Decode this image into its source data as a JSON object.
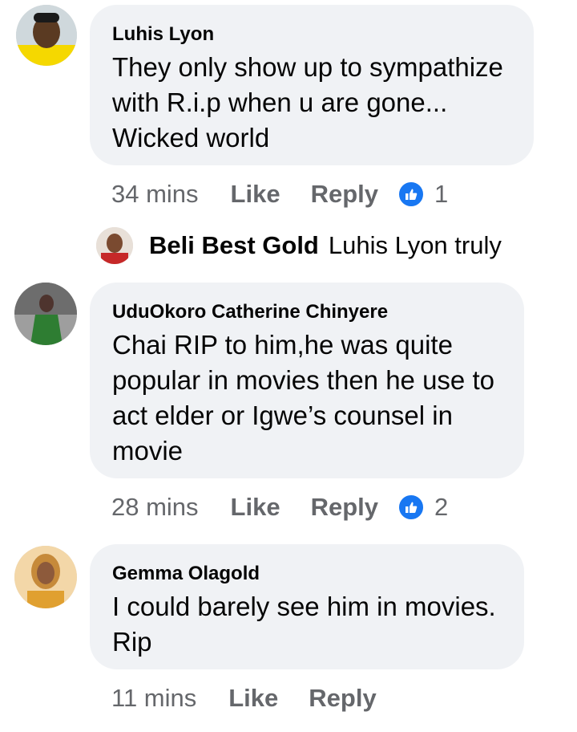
{
  "comments": [
    {
      "author": "Luhis Lyon",
      "text_lines": [
        "They only show up to sympathize",
        "with R.i.p when u are gone...",
        "Wicked world"
      ],
      "time": "34 mins",
      "like_label": "Like",
      "reply_label": "Reply",
      "reaction_icon": "thumbs-up-icon",
      "reaction_count": "1",
      "reply": {
        "author": "Beli Best Gold",
        "text": "Luhis Lyon truly"
      }
    },
    {
      "author": "UduOkoro Catherine Chinyere",
      "text_lines": [
        "Chai RIP to him,he was quite",
        "popular in movies then he use to",
        "act elder or Igwe’s  counsel in",
        "movie"
      ],
      "time": "28 mins",
      "like_label": "Like",
      "reply_label": "Reply",
      "reaction_icon": "thumbs-up-icon",
      "reaction_count": "2"
    },
    {
      "author": "Gemma Olagold",
      "text_lines": [
        "I could barely see him in movies.",
        "Rip"
      ],
      "time": "11 mins",
      "like_label": "Like",
      "reply_label": "Reply"
    }
  ],
  "colors": {
    "bubble_bg": "#f0f2f5",
    "meta_text": "#65676b",
    "like_blue": "#1877f2"
  }
}
